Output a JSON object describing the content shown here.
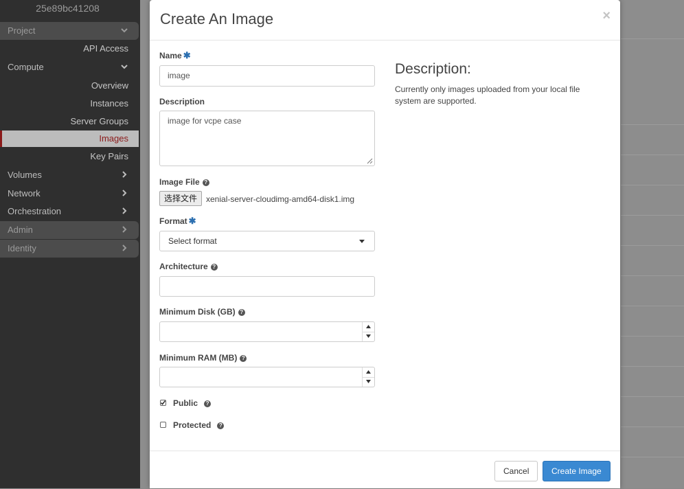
{
  "sidebar": {
    "project_id": "25e89bc41208",
    "project_label": "Project",
    "api_access": "API Access",
    "compute_label": "Compute",
    "compute_items": [
      "Overview",
      "Instances",
      "Server Groups",
      "Images",
      "Key Pairs"
    ],
    "volumes": "Volumes",
    "network": "Network",
    "orchestration": "Orchestration",
    "admin": "Admin",
    "identity": "Identity"
  },
  "modal": {
    "title": "Create An Image",
    "close": "×",
    "name_label": "Name",
    "name_value": "image",
    "description_label": "Description",
    "description_value": "image for vcpe case",
    "image_file_label": "Image File",
    "file_button": "选择文件",
    "file_name": "xenial-server-cloudimg-amd64-disk1.img",
    "format_label": "Format",
    "format_value": "Select format",
    "architecture_label": "Architecture",
    "min_disk_label": "Minimum Disk (GB)",
    "min_ram_label": "Minimum RAM (MB)",
    "public_label": "Public",
    "public_checked": true,
    "protected_label": "Protected",
    "protected_checked": false,
    "help_title": "Description:",
    "help_text": "Currently only images uploaded from your local file system are supported.",
    "cancel": "Cancel",
    "create": "Create Image"
  },
  "colors": {
    "primary": "#3a89d2",
    "required": "#2c6fb0",
    "active_nav": "#8b1a1a"
  }
}
